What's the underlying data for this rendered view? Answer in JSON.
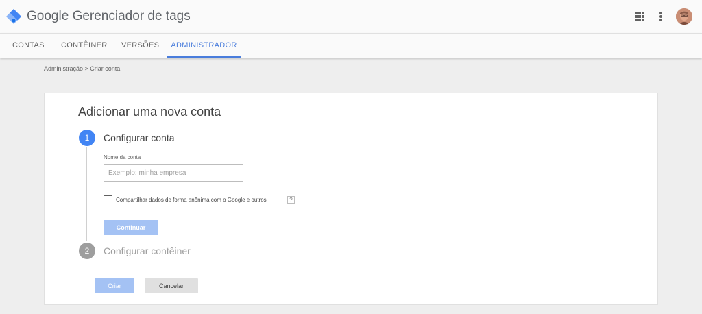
{
  "header": {
    "brand_google": "Google",
    "brand_product": "Gerenciador de tags",
    "icons": {
      "logo": "gtm-diamond-logo",
      "apps": "apps-grid-icon",
      "more": "more-vert-icon",
      "avatar": "user-avatar"
    }
  },
  "nav": {
    "tabs": [
      {
        "label": "CONTAS",
        "active": false
      },
      {
        "label": "CONTÊINER",
        "active": false
      },
      {
        "label": "VERSÕES",
        "active": false
      },
      {
        "label": "ADMINISTRADOR",
        "active": true
      }
    ]
  },
  "breadcrumb": "Administração > Criar conta",
  "card": {
    "title": "Adicionar uma nova conta",
    "step1": {
      "number": "1",
      "title": "Configurar conta",
      "field_label": "Nome da conta",
      "field_value": "",
      "field_placeholder": "Exemplo: minha empresa",
      "checkbox_label": "Compartilhar dados de forma anônima com o Google e outros",
      "checkbox_checked": false,
      "help": "?",
      "continue_label": "Continuar"
    },
    "step2": {
      "number": "2",
      "title": "Configurar contêiner"
    },
    "create_label": "Criar",
    "cancel_label": "Cancelar"
  },
  "colors": {
    "accent": "#4285f4",
    "tab_active": "#4a7ddc",
    "disabled_button": "#a4c2f4",
    "background": "#eeeeee"
  }
}
